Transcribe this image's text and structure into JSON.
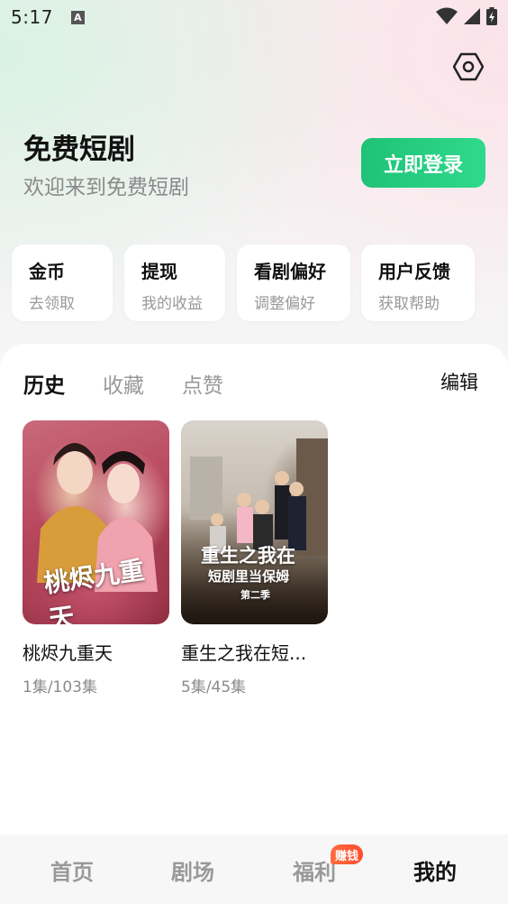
{
  "status_bar": {
    "time": "5:17",
    "notification_letter": "A"
  },
  "header": {
    "title": "免费短剧",
    "subtitle": "欢迎来到免费短剧",
    "login_label": "立即登录"
  },
  "cards": [
    {
      "title": "金币",
      "subtitle": "去领取"
    },
    {
      "title": "提现",
      "subtitle": "我的收益"
    },
    {
      "title": "看剧偏好",
      "subtitle": "调整偏好"
    },
    {
      "title": "用户反馈",
      "subtitle": "获取帮助"
    }
  ],
  "tabs": [
    {
      "label": "历史",
      "active": true
    },
    {
      "label": "收藏",
      "active": false
    },
    {
      "label": "点赞",
      "active": false
    }
  ],
  "edit_label": "编辑",
  "history": [
    {
      "title": "桃烬九重天",
      "episodes": "1集/103集",
      "poster_text": "桃烬九重天"
    },
    {
      "title": "重生之我在短...",
      "episodes": "5集/45集",
      "poster_text_line1": "重生之我在",
      "poster_text_line2": "短剧里当保姆",
      "poster_text_line3": "第二季"
    }
  ],
  "bottom_nav": [
    {
      "label": "首页",
      "active": false
    },
    {
      "label": "剧场",
      "active": false
    },
    {
      "label": "福利",
      "active": false
    },
    {
      "label": "我的",
      "active": true
    }
  ],
  "nav_badge": "赚钱",
  "colors": {
    "accent": "#1fc276",
    "badge": "#ff5a33"
  }
}
